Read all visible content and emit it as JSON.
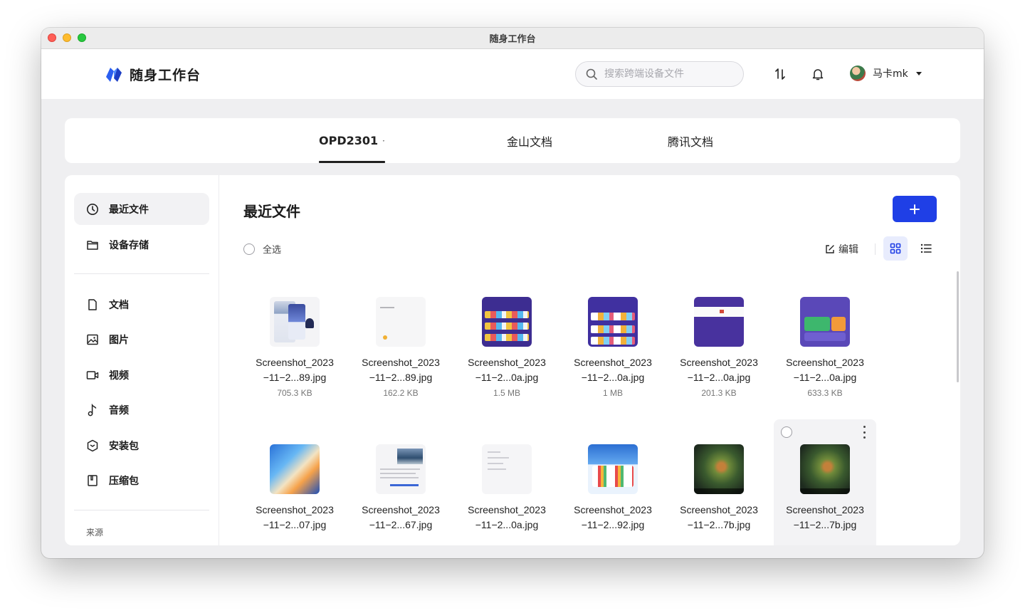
{
  "window": {
    "title": "随身工作台"
  },
  "app": {
    "name": "随身工作台"
  },
  "search": {
    "placeholder": "搜索跨端设备文件"
  },
  "user": {
    "name": "马卡mk"
  },
  "device_tabs": [
    {
      "label": "OPD2301",
      "active": true
    },
    {
      "label": "金山文档",
      "active": false
    },
    {
      "label": "腾讯文档",
      "active": false
    }
  ],
  "sidebar": {
    "items": [
      {
        "label": "最近文件",
        "icon": "clock-icon",
        "active": true
      },
      {
        "label": "设备存储",
        "icon": "folder-icon",
        "active": false
      },
      {
        "label": "文档",
        "icon": "document-icon",
        "active": false
      },
      {
        "label": "图片",
        "icon": "image-icon",
        "active": false
      },
      {
        "label": "视频",
        "icon": "video-icon",
        "active": false
      },
      {
        "label": "音频",
        "icon": "music-note-icon",
        "active": false
      },
      {
        "label": "安装包",
        "icon": "package-icon",
        "active": false
      },
      {
        "label": "压缩包",
        "icon": "archive-icon",
        "active": false
      }
    ],
    "source_label": "来源"
  },
  "content": {
    "title": "最近文件",
    "select_all": "全选",
    "edit": "编辑",
    "add_button": "+"
  },
  "files": [
    {
      "name_line1": "Screenshot_2023",
      "name_line2": "−11−2...89.jpg",
      "size": "705.3 KB",
      "thumb": "phone"
    },
    {
      "name_line1": "Screenshot_2023",
      "name_line2": "−11−2...89.jpg",
      "size": "162.2 KB",
      "thumb": "white"
    },
    {
      "name_line1": "Screenshot_2023",
      "name_line2": "−11−2...0a.jpg",
      "size": "1.5 MB",
      "thumb": "purple"
    },
    {
      "name_line1": "Screenshot_2023",
      "name_line2": "−11−2...0a.jpg",
      "size": "1 MB",
      "thumb": "purple2"
    },
    {
      "name_line1": "Screenshot_2023",
      "name_line2": "−11−2...0a.jpg",
      "size": "201.3 KB",
      "thumb": "deep"
    },
    {
      "name_line1": "Screenshot_2023",
      "name_line2": "−11−2...0a.jpg",
      "size": "633.3 KB",
      "thumb": "green"
    },
    {
      "name_line1": "Screenshot_2023",
      "name_line2": "−11−2...07.jpg",
      "size": "",
      "thumb": "wave"
    },
    {
      "name_line1": "Screenshot_2023",
      "name_line2": "−11−2...67.jpg",
      "size": "",
      "thumb": "sheet"
    },
    {
      "name_line1": "Screenshot_2023",
      "name_line2": "−11−2...0a.jpg",
      "size": "",
      "thumb": "doc"
    },
    {
      "name_line1": "Screenshot_2023",
      "name_line2": "−11−2...92.jpg",
      "size": "",
      "thumb": "tablet"
    },
    {
      "name_line1": "Screenshot_2023",
      "name_line2": "−11−2...7b.jpg",
      "size": "",
      "thumb": "game"
    },
    {
      "name_line1": "Screenshot_2023",
      "name_line2": "−11−2...7b.jpg",
      "size": "",
      "thumb": "game"
    }
  ],
  "colors": {
    "accent": "#1f3fe6",
    "grid_toggle_bg": "#e8ecfd",
    "page_bg": "#efeff1"
  }
}
